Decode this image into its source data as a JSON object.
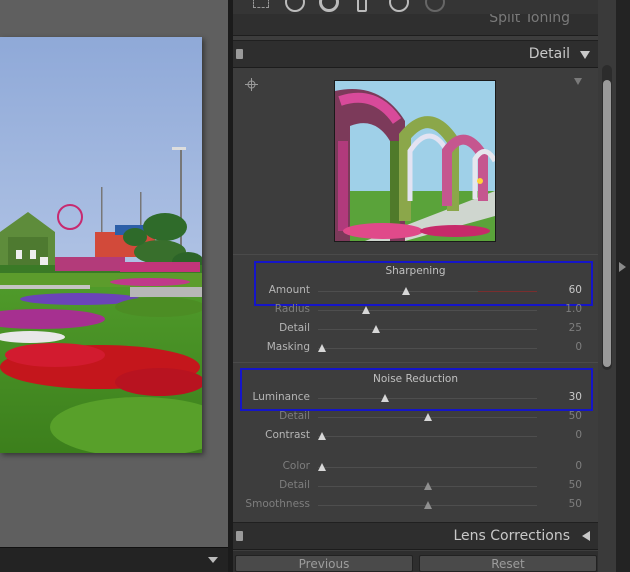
{
  "panels": {
    "split_toning": {
      "title": "Split Toning"
    },
    "detail": {
      "title": "Detail"
    },
    "lens_corrections": {
      "title": "Lens Corrections"
    }
  },
  "sharpening": {
    "section_title": "Sharpening",
    "sliders": [
      {
        "label": "Amount",
        "value": "60",
        "fraction": 0.4
      },
      {
        "label": "Radius",
        "value": "1.0",
        "fraction": 0.22
      },
      {
        "label": "Detail",
        "value": "25",
        "fraction": 0.265
      },
      {
        "label": "Masking",
        "value": "0",
        "fraction": 0.02
      }
    ]
  },
  "noise_reduction": {
    "section_title": "Noise Reduction",
    "sliders": [
      {
        "label": "Luminance",
        "value": "30",
        "fraction": 0.305
      },
      {
        "label": "Detail",
        "value": "50",
        "fraction": 0.5
      },
      {
        "label": "Contrast",
        "value": "0",
        "fraction": 0.02
      },
      {
        "label": "Color",
        "value": "0",
        "fraction": 0.02
      },
      {
        "label": "Detail",
        "value": "50",
        "fraction": 0.5
      },
      {
        "label": "Smoothness",
        "value": "50",
        "fraction": 0.5
      }
    ]
  },
  "buttons": {
    "previous": "Previous",
    "reset": "Reset"
  },
  "colors": {
    "highlight": "#1515c8",
    "panel_bg": "#3d3d3d",
    "header_bg": "#2e2e2e"
  },
  "icons": [
    "target-adjustment-icon",
    "collapse-triangle-icon",
    "panel-switch-icon"
  ]
}
